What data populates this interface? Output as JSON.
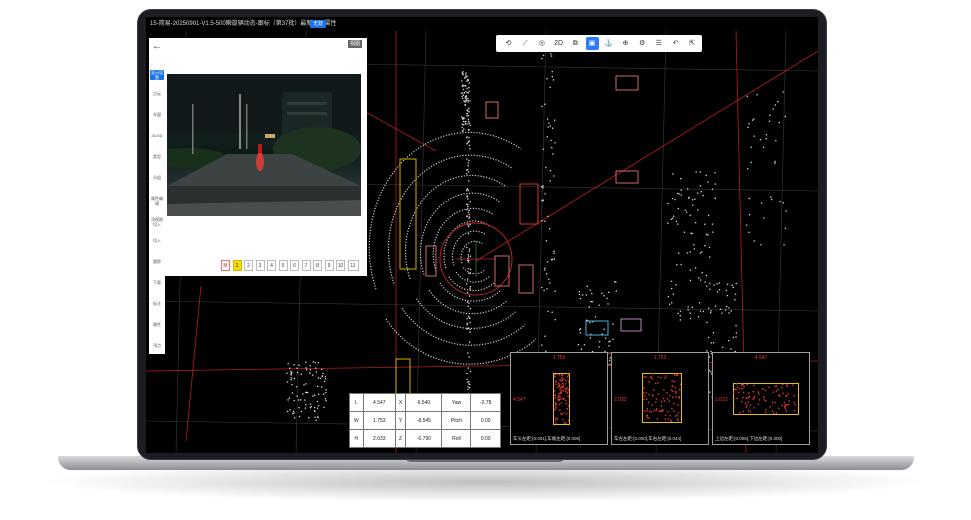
{
  "window": {
    "title": "15-简易-20250901-V1.5-500瞬旋辆动态-跟标（第37批）最新可见属性",
    "tag": "无效"
  },
  "sidebar": {
    "back_icon": "arrow-left-icon",
    "items": [
      "显示设置",
      "点云",
      "车窗",
      "2D/3D",
      "类型",
      "分组",
      "属性编辑",
      "顶视图切入",
      "切入",
      "跟踪",
      "下载",
      "标注",
      "属性",
      "顶点"
    ]
  },
  "camera_panel": {
    "badge": "视图",
    "pages": [
      "M",
      "1",
      "2",
      "3",
      "4",
      "5",
      "6",
      "7",
      "8",
      "9",
      "10",
      "11"
    ],
    "active_page": "1"
  },
  "toolbar": {
    "items": [
      {
        "icon": "reset-icon",
        "label": "⟲"
      },
      {
        "icon": "ruler-icon",
        "label": "⟋"
      },
      {
        "icon": "target-icon",
        "label": "◎"
      },
      {
        "icon": "2d-toggle",
        "label": "2D"
      },
      {
        "icon": "copy-icon",
        "label": "⧉"
      },
      {
        "icon": "cube-icon",
        "label": "▣"
      },
      {
        "icon": "anchor-icon",
        "label": "⚓"
      },
      {
        "icon": "zoom-icon",
        "label": "⊕"
      },
      {
        "icon": "settings-icon",
        "label": "⚙"
      },
      {
        "icon": "list-icon",
        "label": "☰"
      },
      {
        "icon": "undo-icon",
        "label": "↶"
      },
      {
        "icon": "export-icon",
        "label": "⇱"
      }
    ],
    "active_index": 5
  },
  "dimensions": {
    "rows": [
      {
        "k1": "L",
        "v1": "4.547",
        "k2": "X",
        "v2": "6.540",
        "k3": "Yaw",
        "v3": "-2.78"
      },
      {
        "k1": "W",
        "v1": "1.753",
        "k2": "Y",
        "v2": "-8.545",
        "k3": "Pitch",
        "v3": "0.00"
      },
      {
        "k1": "H",
        "v1": "2.033",
        "k2": "Z",
        "v2": "-0.790",
        "k3": "Roll",
        "v3": "0.00"
      }
    ]
  },
  "views": [
    {
      "top": "1.753",
      "side": "4.547",
      "caption": "车头左距:[0.001],车尾左距:[0.000]"
    },
    {
      "top": "1.753",
      "side": "2.033",
      "caption": "车左左距:[0.000],车右左距:[0.044]"
    },
    {
      "top": "4.547",
      "side": "2.033",
      "caption": "上边左距:[0.008],下边左距:[0.000]"
    }
  ],
  "colors": {
    "accent": "#1a73e8",
    "box": "#e53935",
    "highlight": "#f5d90a"
  }
}
